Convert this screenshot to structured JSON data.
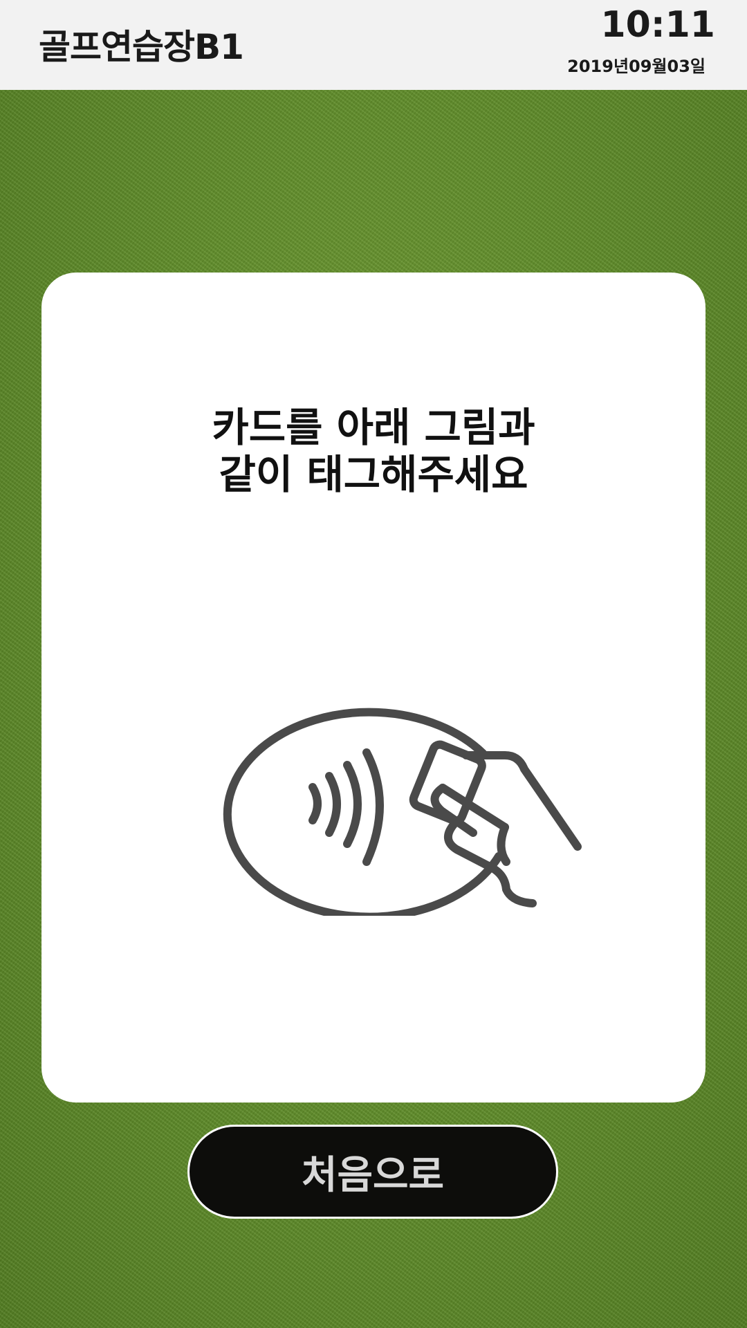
{
  "header": {
    "venue_name": "골프연습장B1",
    "time": "10:11",
    "date": "2019년09월03일"
  },
  "main": {
    "instruction_line1": "카드를 아래 그림과",
    "instruction_line2": "같이 태그해주세요",
    "illustration_icon": "contactless-card-tap-icon"
  },
  "footer": {
    "home_button_label": "처음으로"
  },
  "colors": {
    "header_bg": "#f2f2f2",
    "panel_bg": "#ffffff",
    "icon_stroke": "#4a4a4a",
    "button_bg": "#0d0d0b",
    "button_text": "#d8d8d8",
    "background_grass": "#5f8c28"
  }
}
